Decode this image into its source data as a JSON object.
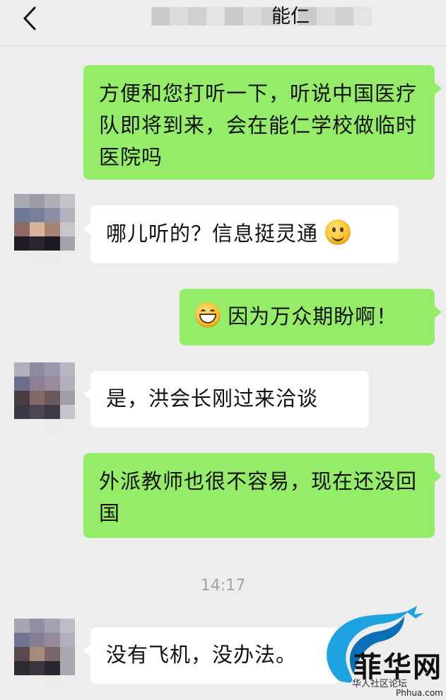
{
  "header": {
    "title": "能仁",
    "back_icon": "chevron-left-icon"
  },
  "colors": {
    "background": "#ededed",
    "outgoing_bubble": "#95ec69",
    "incoming_bubble": "#ffffff",
    "timestamp": "#a4a4a4"
  },
  "messages": [
    {
      "direction": "out",
      "text": "方便和您打听一下，听说中国医疗队即将到来，会在能仁学校做临时医院吗"
    },
    {
      "direction": "in",
      "text": "哪儿听的？信息挺灵通",
      "emoji": "slight-smile-emoji"
    },
    {
      "direction": "out",
      "text": "因为万众期盼啊！",
      "emoji": "grin-emoji"
    },
    {
      "direction": "in",
      "text": "是，洪会长刚过来洽谈"
    },
    {
      "direction": "out",
      "text": "外派教师也很不容易，现在还没回国"
    },
    {
      "direction": "in",
      "text": "没有飞机，没办法。"
    }
  ],
  "timestamp": "14:17",
  "watermark": {
    "logo": "dragon-logo",
    "brand": "菲华网",
    "sub": "华人社区论坛",
    "url": "Phhua.com"
  }
}
